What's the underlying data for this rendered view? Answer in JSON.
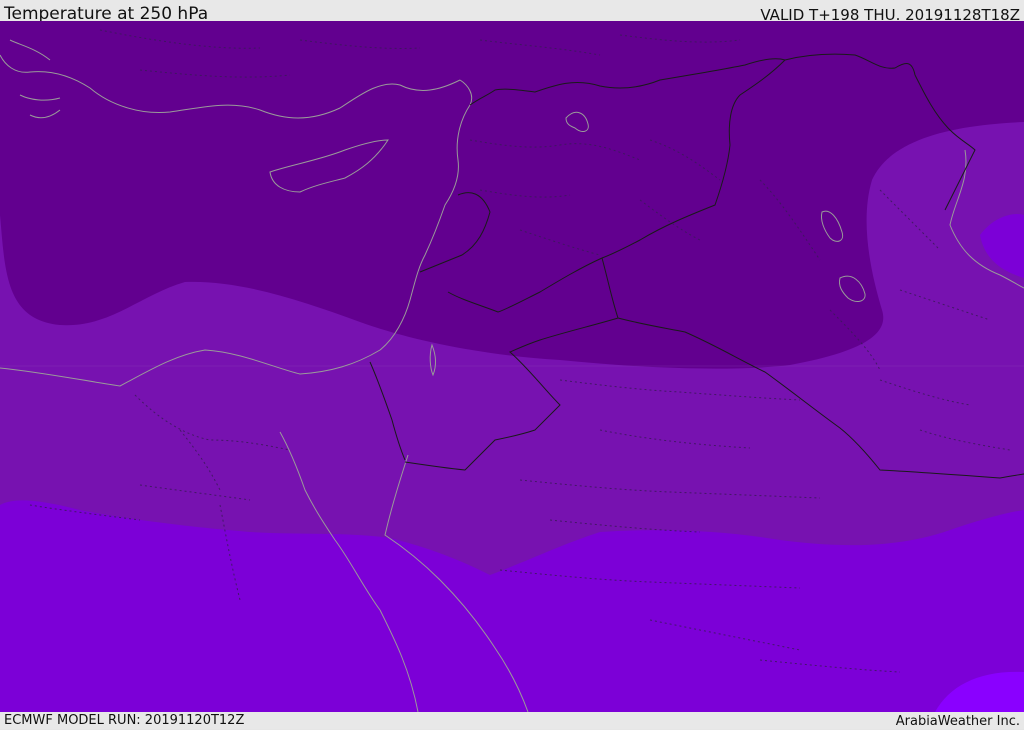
{
  "header": {
    "title": "Temperature at 250 hPa",
    "valid": "VALID T+198 THU. 20191128T18Z"
  },
  "footer": {
    "model_run": "ECMWF MODEL RUN: 20191120T12Z",
    "credit": "ArabiaWeather Inc."
  },
  "colors": {
    "coldest_band": "#62008f",
    "mid_band": "#7712b0",
    "warm_band": "#7c00d7",
    "warmest_band": "#8a00ff",
    "coastline": "#9a9a9a",
    "border": "#1a1a1a"
  }
}
